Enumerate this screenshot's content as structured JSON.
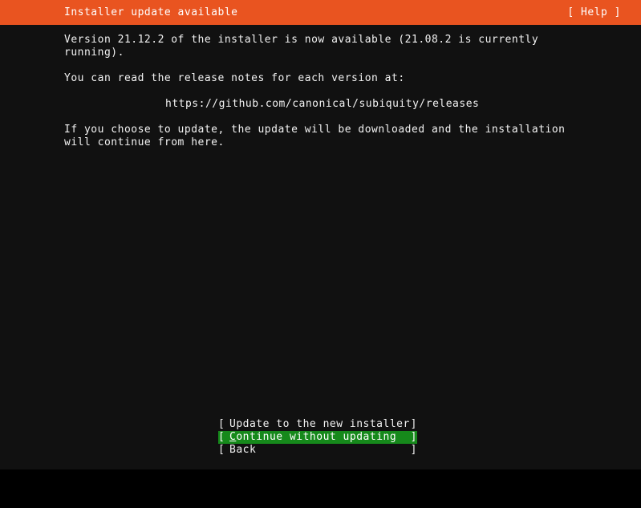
{
  "header": {
    "title": "Installer update available",
    "help_label": "[ Help ]",
    "background_color": "#e95420",
    "text_color": "#ffffff"
  },
  "screen": {
    "background_color": "#111111",
    "text_color": "#f2f2f2",
    "highlight_color": "#16891b"
  },
  "body": {
    "paragraph_1": "Version 21.12.2 of the installer is now available (21.08.2 is currently\nrunning).",
    "paragraph_2": "You can read the release notes for each version at:",
    "release_notes_url": "https://github.com/canonical/subiquity/releases",
    "paragraph_3": "If you choose to update, the update will be downloaded and the installation\nwill continue from here."
  },
  "buttons": {
    "bracket_open": "[",
    "bracket_close": "]",
    "items": [
      {
        "label": "Update to the new installer",
        "accel": "",
        "rest": "Update to the new installer",
        "selected": false
      },
      {
        "label": "Continue without updating",
        "accel": "C",
        "rest": "ontinue without updating",
        "selected": true
      },
      {
        "label": "Back",
        "accel": "",
        "rest": "Back",
        "selected": false
      }
    ]
  }
}
